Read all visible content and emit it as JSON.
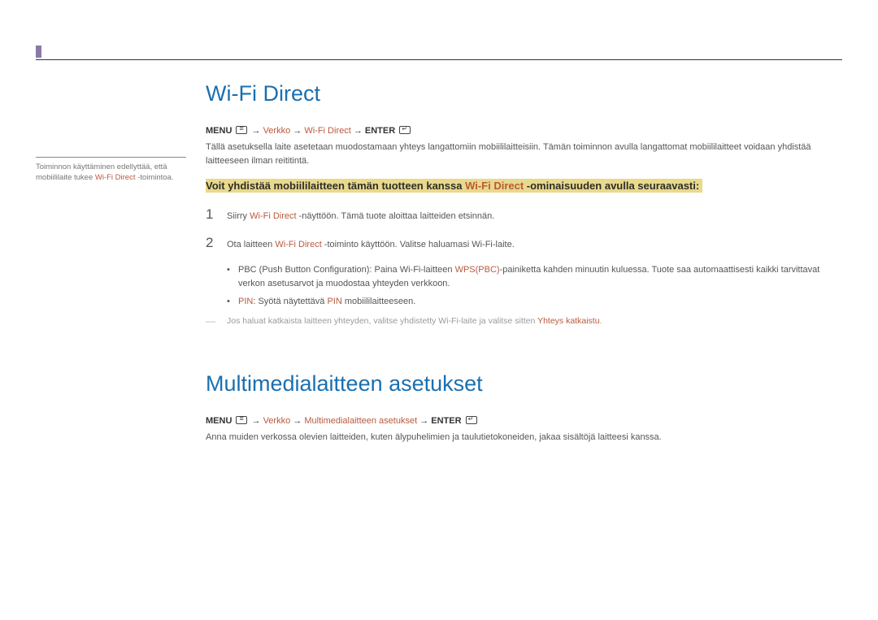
{
  "side": {
    "note_prefix": "Toiminnon käyttäminen edellyttää, että mobiililaite tukee ",
    "note_hl": "Wi-Fi Direct",
    "note_suffix": " -toimintoa."
  },
  "section1": {
    "title": "Wi-Fi Direct",
    "path_menu": "MENU",
    "path_seg1": "Verkko",
    "path_seg2": "Wi-Fi Direct",
    "path_enter": "ENTER",
    "intro": "Tällä asetuksella laite asetetaan muodostamaan yhteys langattomiin mobiililaitteisiin. Tämän toiminnon avulla langattomat mobiililaitteet voidaan yhdistää laitteeseen ilman reititintä.",
    "band_p1": "Voit yhdistää mobiililaitteen tämän tuotteen kanssa ",
    "band_hl": "Wi-Fi Direct",
    "band_p2": " -ominaisuuden avulla seuraavasti:",
    "steps": [
      {
        "num": "1",
        "pre": "Siirry ",
        "hl": "Wi-Fi Direct",
        "post": " -näyttöön. Tämä tuote aloittaa laitteiden etsinnän."
      },
      {
        "num": "2",
        "pre": "Ota laitteen ",
        "hl": "Wi-Fi Direct",
        "post": " -toiminto käyttöön. Valitse haluamasi Wi-Fi-laite."
      }
    ],
    "bullets": [
      {
        "pre": "PBC (Push Button Configuration): Paina Wi-Fi-laitteen ",
        "hl": "WPS(PBC)",
        "post": "-painiketta kahden minuutin kuluessa. Tuote saa automaattisesti kaikki tarvittavat verkon asetusarvot ja muodostaa yhteyden verkkoon."
      },
      {
        "pre": "",
        "hl": "PIN",
        "mid": ": Syötä näytettävä ",
        "hl2": "PIN",
        "post": " mobiililaitteeseen."
      }
    ],
    "note_prefix": "Jos haluat katkaista laitteen yhteyden, valitse yhdistetty Wi-Fi-laite ja valitse sitten ",
    "note_hl": "Yhteys katkaistu",
    "note_suffix": "."
  },
  "section2": {
    "title": "Multimedialaitteen asetukset",
    "path_menu": "MENU",
    "path_seg1": "Verkko",
    "path_seg2": "Multimedialaitteen asetukset",
    "path_enter": "ENTER",
    "intro": "Anna muiden verkossa olevien laitteiden, kuten älypuhelimien ja taulutietokoneiden, jakaa sisältöjä laitteesi kanssa."
  },
  "arrow": " → ",
  "note_dash": "―"
}
